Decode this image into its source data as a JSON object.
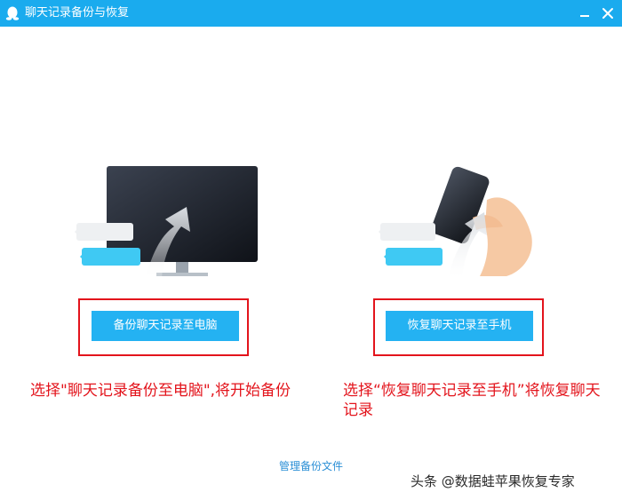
{
  "window": {
    "title": "聊天记录备份与恢复"
  },
  "actions": {
    "backup_label": "备份聊天记录至电脑",
    "restore_label": "恢复聊天记录至手机"
  },
  "notes": {
    "left": "选择\"聊天记录备份至电脑\",将开始备份",
    "right": "选择“恢复聊天记录至手机”将恢复聊天记录"
  },
  "footer": {
    "manage_label": "管理备份文件",
    "watermark": "头条 @数据蛙苹果恢复专家"
  },
  "colors": {
    "titlebar": "#1aabee",
    "button": "#24b2f2",
    "highlight": "#e3141c",
    "link": "#2b8fd6"
  },
  "icons": {
    "app": "qq-penguin-icon",
    "minimize": "minimize-icon",
    "close": "close-icon",
    "left_illustration": "monitor-upload-illustration",
    "right_illustration": "phone-in-hand-illustration"
  }
}
